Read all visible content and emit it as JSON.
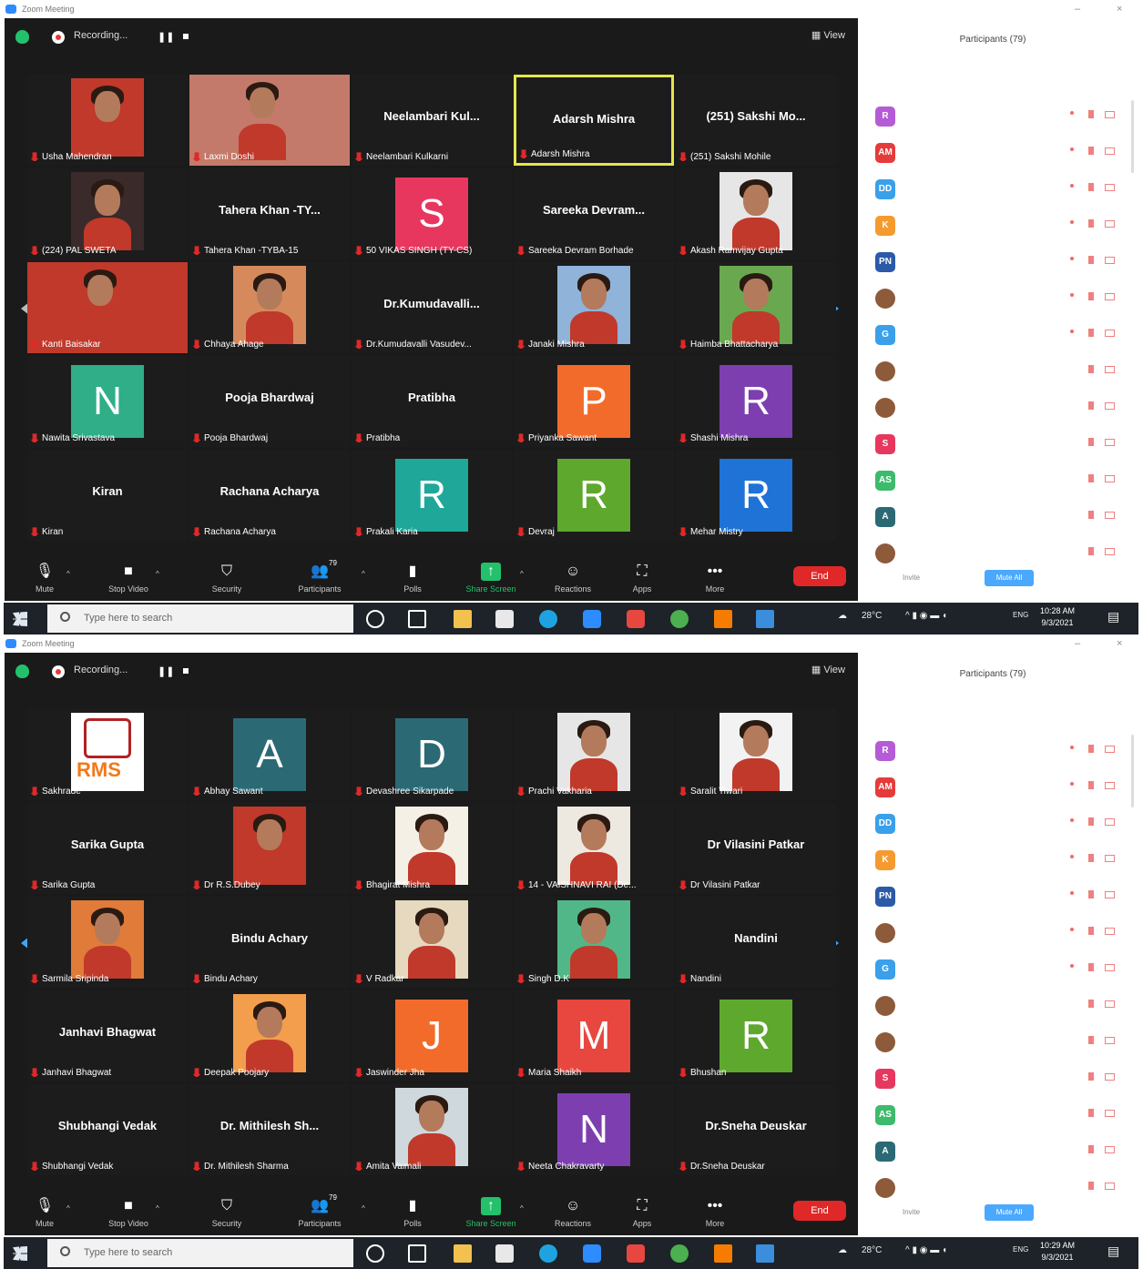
{
  "app_title": "Zoom Meeting",
  "shots": [
    {
      "top_bar": {
        "recording": "Recording...",
        "view": "View"
      },
      "tiles": [
        {
          "type": "photo",
          "name": "Usha Mahendran",
          "color": "#c0392b"
        },
        {
          "type": "photo",
          "name": "Laxmi Doshi",
          "wide": true,
          "color": "#c47a6a"
        },
        {
          "type": "text",
          "big": "Neelambari Kul...",
          "name": "Neelambari Kulkarni"
        },
        {
          "type": "text",
          "big": "Adarsh Mishra",
          "name": "Adarsh Mishra",
          "active": true
        },
        {
          "type": "text",
          "big": "(251) Sakshi Mo...",
          "name": "(251) Sakshi Mohile"
        },
        {
          "type": "photo",
          "name": "(224) PAL SWETA",
          "color": "#3a2a2a"
        },
        {
          "type": "text",
          "big": "Tahera Khan -TY...",
          "name": "Tahera Khan -TYBA-15"
        },
        {
          "type": "letter",
          "letter": "S",
          "color": "#e8375f",
          "name": "50 VIKAS SINGH (TY-CS)"
        },
        {
          "type": "text",
          "big": "Sareeka  Devram...",
          "name": "Sareeka Devram Borhade"
        },
        {
          "type": "photo",
          "name": "Akash Ramvijay Gupta",
          "color": "#e6e6e6"
        },
        {
          "type": "photo",
          "name": "Kanti Baisakar",
          "wide": true,
          "color": "#c0392b"
        },
        {
          "type": "photo",
          "name": "Chhaya Ahage",
          "color": "#d68a5c"
        },
        {
          "type": "text",
          "big": "Dr.Kumudavalli...",
          "name": "Dr.Kumudavalli Vasudev..."
        },
        {
          "type": "photo",
          "name": "Janaki Mishra",
          "color": "#8fb3d9"
        },
        {
          "type": "photo",
          "name": "Haimba Bhattacharya",
          "color": "#6aa84f"
        },
        {
          "type": "letter",
          "letter": "N",
          "color": "#2fae88",
          "name": "Nawita Srivastava"
        },
        {
          "type": "text",
          "big": "Pooja Bhardwaj",
          "name": "Pooja Bhardwaj"
        },
        {
          "type": "text",
          "big": "Pratibha",
          "name": "Pratibha"
        },
        {
          "type": "letter",
          "letter": "P",
          "color": "#f26b2b",
          "name": "Priyanka Sawant"
        },
        {
          "type": "letter",
          "letter": "R",
          "color": "#7d3fb0",
          "name": "Shashi Mishra"
        },
        {
          "type": "text",
          "big": "Kiran",
          "name": "Kiran"
        },
        {
          "type": "text",
          "big": "Rachana Acharya",
          "name": "Rachana Acharya"
        },
        {
          "type": "letter",
          "letter": "R",
          "color": "#1fa79a",
          "name": "Prakali Karia"
        },
        {
          "type": "letter",
          "letter": "R",
          "color": "#5ea82e",
          "name": "Devraj"
        },
        {
          "type": "letter",
          "letter": "R",
          "color": "#1f73d6",
          "name": "Mehar Mistry"
        }
      ],
      "controls": {
        "mute": "Mute",
        "video": "Stop Video",
        "security": "Security",
        "participants": "Participants",
        "participants_count": "79",
        "polls": "Polls",
        "share": "Share Screen",
        "reactions": "Reactions",
        "apps": "Apps",
        "more": "More",
        "end": "End"
      },
      "panel": {
        "title": "Participants (79)",
        "mute_all": "Mute All",
        "invite": "Invite",
        "participants": [
          {
            "initials": "R",
            "color": "#b65bd6"
          },
          {
            "initials": "AM",
            "color": "#e63b3b"
          },
          {
            "initials": "DD",
            "color": "#3aa0ea"
          },
          {
            "initials": "K",
            "color": "#f59a2f"
          },
          {
            "initials": "PN",
            "color": "#2b5aa8"
          },
          {
            "initials": "",
            "photo": true
          },
          {
            "initials": "G",
            "color": "#3aa0ea"
          },
          {
            "initials": "",
            "photo": true
          },
          {
            "initials": "",
            "photo": true
          },
          {
            "initials": "S",
            "color": "#e8375f"
          },
          {
            "initials": "AS",
            "color": "#3dbb6c"
          },
          {
            "initials": "A",
            "color": "#2b6a75"
          },
          {
            "initials": "",
            "photo": true
          }
        ]
      },
      "taskbar": {
        "search_placeholder": "Type here to search",
        "weather": "28°C",
        "lang": "ENG",
        "time": "10:28 AM",
        "date": "9/3/2021"
      }
    },
    {
      "top_bar": {
        "recording": "Recording...",
        "view": "View"
      },
      "tiles": [
        {
          "type": "logo",
          "name": "Sakhrade",
          "text": "RMS"
        },
        {
          "type": "letter",
          "letter": "A",
          "color": "#2b6a75",
          "name": "Abhay Sawant"
        },
        {
          "type": "letter",
          "letter": "D",
          "color": "#2b6a75",
          "name": "Devashree Sikarpade"
        },
        {
          "type": "photo",
          "name": "Prachi Vakharia",
          "color": "#e6e6e6"
        },
        {
          "type": "photo",
          "name": "Saralit Tiwari",
          "color": "#f2f2f2"
        },
        {
          "type": "text",
          "big": "Sarika Gupta",
          "name": "Sarika Gupta"
        },
        {
          "type": "photo",
          "name": "Dr R.S.Dubey",
          "color": "#c0392b"
        },
        {
          "type": "photo",
          "name": "Bhagirat Mishra",
          "color": "#f5f0e6"
        },
        {
          "type": "photo",
          "name": "14 - VAISHNAVI RAI (De...",
          "color": "#ede8e0"
        },
        {
          "type": "text",
          "big": "Dr Vilasini Patkar",
          "name": "Dr Vilasini Patkar"
        },
        {
          "type": "photo",
          "name": "Sarmila Sripinda",
          "color": "#e07b39"
        },
        {
          "type": "text",
          "big": "Bindu Achary",
          "name": "Bindu Achary"
        },
        {
          "type": "photo",
          "name": "V Radkar",
          "color": "#e6d9c0"
        },
        {
          "type": "photo",
          "name": "Singh D.K",
          "color": "#52b788"
        },
        {
          "type": "text",
          "big": "Nandini",
          "name": "Nandini"
        },
        {
          "type": "text",
          "big": "Janhavi Bhagwat",
          "name": "Janhavi Bhagwat"
        },
        {
          "type": "photo",
          "name": "Deepak Poojary",
          "color": "#f29e4c"
        },
        {
          "type": "letter",
          "letter": "J",
          "color": "#f26b2b",
          "name": "Jaswinder Jha"
        },
        {
          "type": "letter",
          "letter": "M",
          "color": "#e8473f",
          "name": "Maria Shaikh"
        },
        {
          "type": "letter",
          "letter": "R",
          "color": "#5ea82e",
          "name": "Bhushan"
        },
        {
          "type": "text",
          "big": "Shubhangi Vedak",
          "name": "Shubhangi Vedak"
        },
        {
          "type": "text",
          "big": "Dr. Mithilesh Sh...",
          "name": "Dr. Mithilesh Sharma"
        },
        {
          "type": "photo",
          "name": "Amita Vaimali",
          "color": "#cfd8dc"
        },
        {
          "type": "letter",
          "letter": "N",
          "color": "#7d3fb0",
          "name": "Neeta Chakravarty"
        },
        {
          "type": "text",
          "big": "Dr.Sneha Deuskar",
          "name": "Dr.Sneha Deuskar"
        }
      ],
      "controls": {
        "mute": "Mute",
        "video": "Stop Video",
        "security": "Security",
        "participants": "Participants",
        "participants_count": "79",
        "polls": "Polls",
        "share": "Share Screen",
        "reactions": "Reactions",
        "apps": "Apps",
        "more": "More",
        "end": "End"
      },
      "panel": {
        "title": "Participants (79)",
        "mute_all": "Mute All",
        "invite": "Invite",
        "participants": [
          {
            "initials": "R",
            "color": "#b65bd6"
          },
          {
            "initials": "AM",
            "color": "#e63b3b"
          },
          {
            "initials": "DD",
            "color": "#3aa0ea"
          },
          {
            "initials": "K",
            "color": "#f59a2f"
          },
          {
            "initials": "PN",
            "color": "#2b5aa8"
          },
          {
            "initials": "",
            "photo": true
          },
          {
            "initials": "G",
            "color": "#3aa0ea"
          },
          {
            "initials": "",
            "photo": true
          },
          {
            "initials": "",
            "photo": true
          },
          {
            "initials": "S",
            "color": "#e8375f"
          },
          {
            "initials": "AS",
            "color": "#3dbb6c"
          },
          {
            "initials": "A",
            "color": "#2b6a75"
          },
          {
            "initials": "",
            "photo": true
          }
        ]
      },
      "taskbar": {
        "search_placeholder": "Type here to search",
        "weather": "28°C",
        "lang": "ENG",
        "time": "10:29 AM",
        "date": "9/3/2021"
      }
    }
  ]
}
